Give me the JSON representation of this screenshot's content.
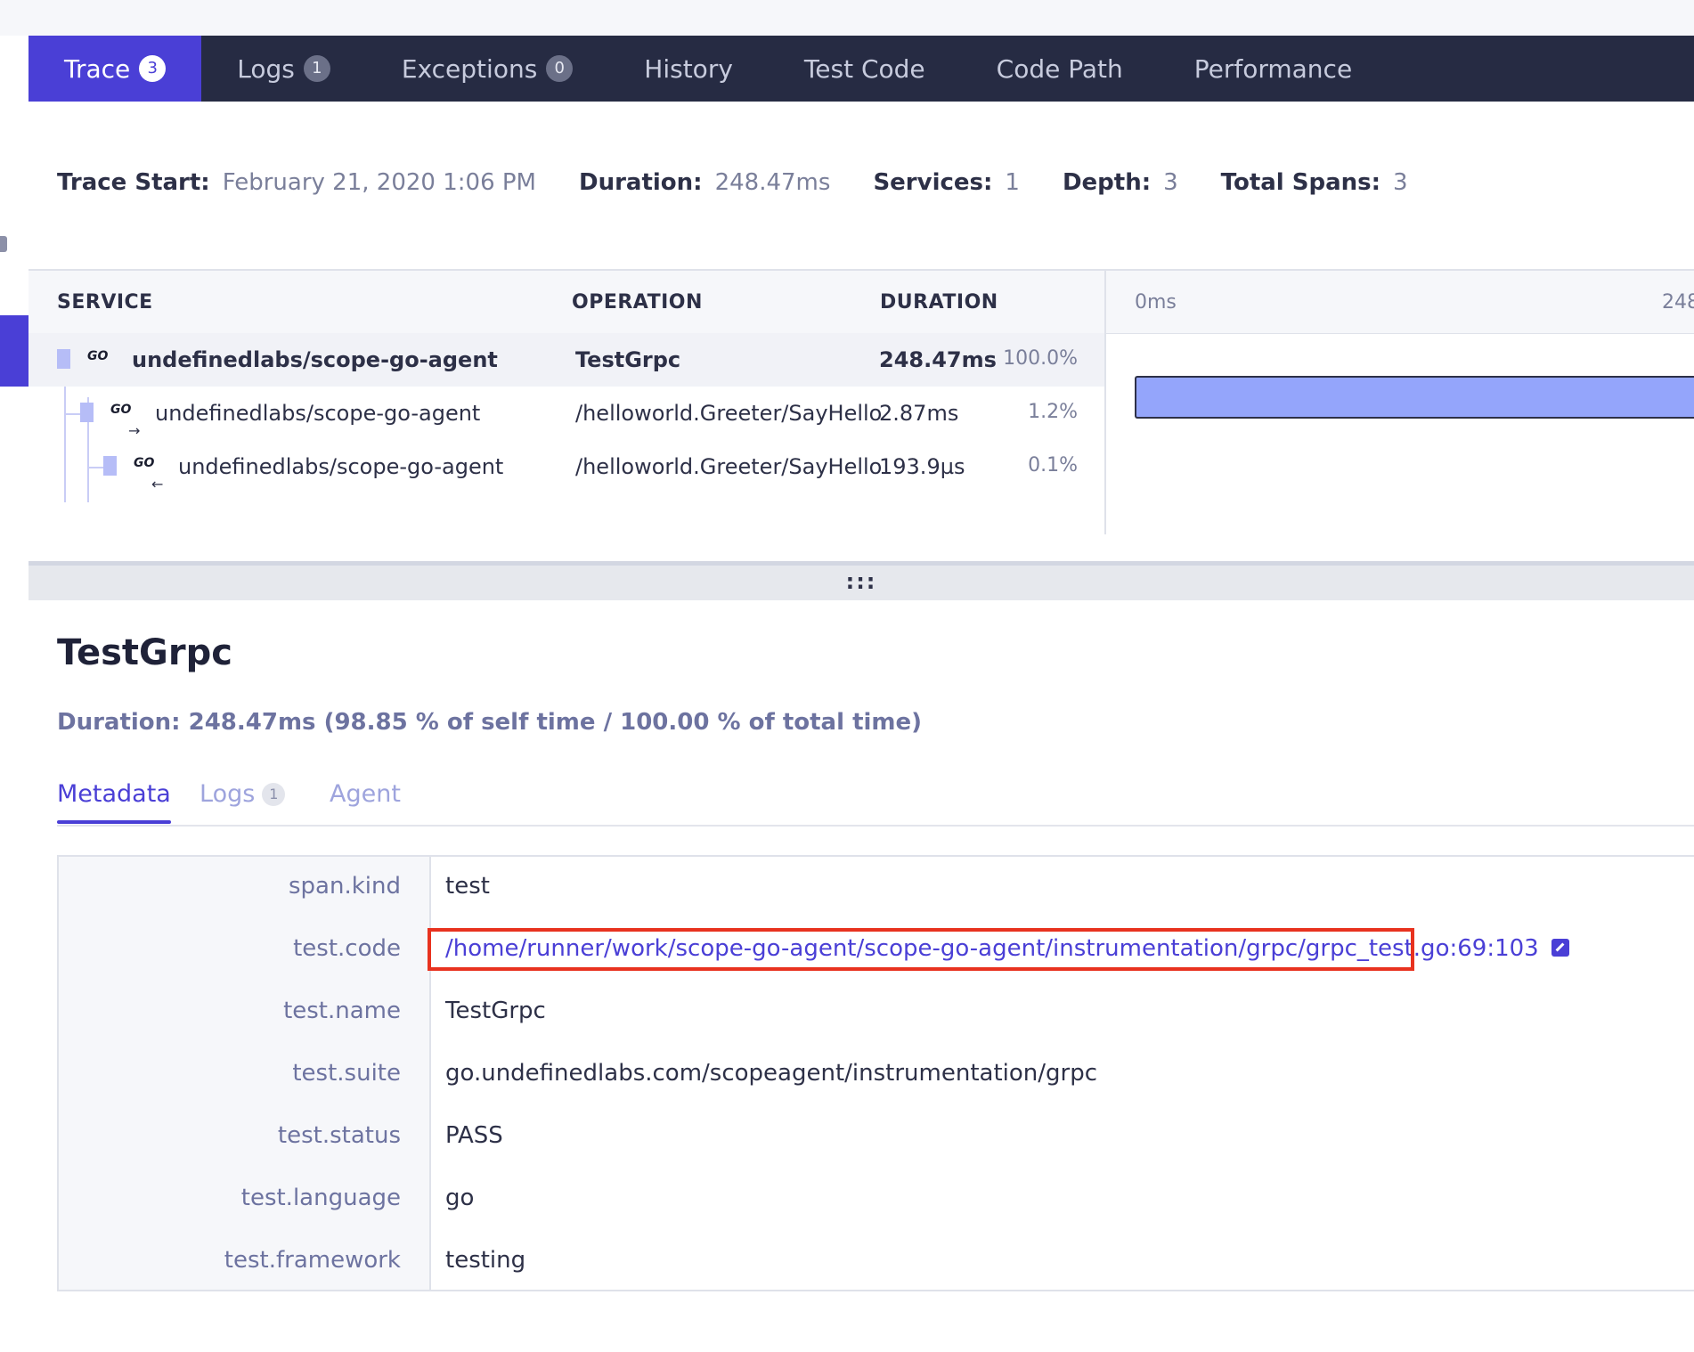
{
  "tabs": [
    {
      "label": "Trace",
      "badge": "3"
    },
    {
      "label": "Logs",
      "badge": "1"
    },
    {
      "label": "Exceptions",
      "badge": "0"
    },
    {
      "label": "History"
    },
    {
      "label": "Test Code"
    },
    {
      "label": "Code Path"
    },
    {
      "label": "Performance"
    }
  ],
  "summary": {
    "trace_start_label": "Trace Start:",
    "trace_start": "February 21, 2020 1:06 PM",
    "duration_label": "Duration:",
    "duration": "248.47ms",
    "services_label": "Services:",
    "services": "1",
    "depth_label": "Depth:",
    "depth": "3",
    "total_spans_label": "Total Spans:",
    "total_spans": "3"
  },
  "spans_table": {
    "headers": {
      "service": "SERVICE",
      "operation": "OPERATION",
      "duration": "DURATION"
    },
    "timeline_start": "0ms",
    "timeline_end": "248",
    "timeline_bar_fraction": 1.0,
    "rows": [
      {
        "service": "undefinedlabs/scope-go-agent",
        "operation": "TestGrpc",
        "duration": "248.47ms",
        "pct": "100.0%"
      },
      {
        "service": "undefinedlabs/scope-go-agent",
        "operation": "/helloworld.Greeter/SayHello",
        "duration": "2.87ms",
        "pct": "1.2%"
      },
      {
        "service": "undefinedlabs/scope-go-agent",
        "operation": "/helloworld.Greeter/SayHello",
        "duration": "193.9µs",
        "pct": "0.1%"
      }
    ],
    "lang_icon_text": "GO",
    "arrow_out": "→",
    "arrow_in": "←"
  },
  "splitter": {
    "grip": ":::"
  },
  "detail": {
    "title": "TestGrpc",
    "duration_text": "Duration: 248.47ms (98.85 % of self time / 100.00 % of total time)",
    "subtabs": [
      {
        "label": "Metadata"
      },
      {
        "label": "Logs",
        "badge": "1"
      },
      {
        "label": "Agent"
      }
    ],
    "metadata": [
      {
        "key": "span.kind",
        "value": "test"
      },
      {
        "key": "test.code",
        "value": "/home/runner/work/scope-go-agent/scope-go-agent/instrumentation/grpc/grpc_test.go:69:103"
      },
      {
        "key": "test.name",
        "value": "TestGrpc"
      },
      {
        "key": "test.suite",
        "value": "go.undefinedlabs.com/scopeagent/instrumentation/grpc"
      },
      {
        "key": "test.status",
        "value": "PASS"
      },
      {
        "key": "test.language",
        "value": "go"
      },
      {
        "key": "test.framework",
        "value": "testing"
      }
    ]
  },
  "colors": {
    "accent": "#4a3fd6",
    "tabbar_bg": "#262b43",
    "timeline_bar": "#94a5fb",
    "highlight_box": "#e8321f"
  }
}
